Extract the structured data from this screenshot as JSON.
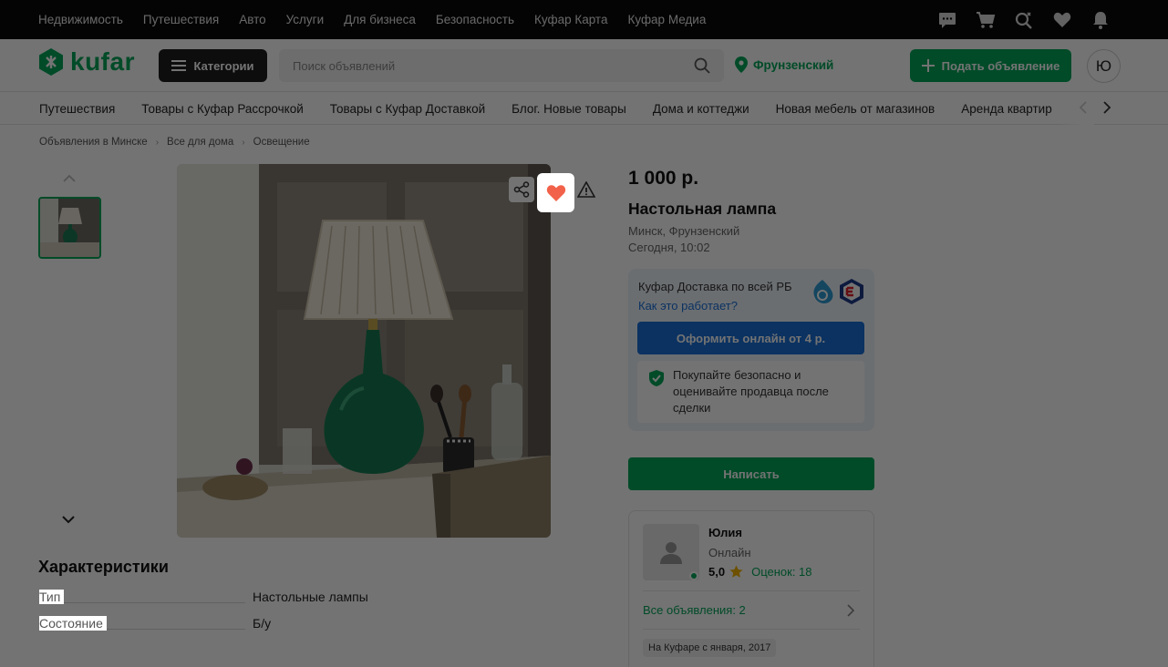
{
  "topbar": {
    "links": [
      "Недвижимость",
      "Путешествия",
      "Авто",
      "Услуги",
      "Для бизнеса",
      "Безопасность",
      "Куфар Карта",
      "Куфар Медиа"
    ],
    "icons": [
      "messages-icon",
      "cart-icon",
      "saved-search-icon",
      "favorites-icon",
      "notifications-icon"
    ]
  },
  "header": {
    "logo_text": "kufar",
    "categories_label": "Категории",
    "search_placeholder": "Поиск объявлений",
    "location_label": "Фрунзенский",
    "post_ad_label": "Подать объявление",
    "avatar_letter": "Ю"
  },
  "quick_nav": {
    "items": [
      "Путешествия",
      "Товары с Куфар Рассрочкой",
      "Товары с Куфар Доставкой",
      "Блог. Новые товары",
      "Дома и коттеджи",
      "Новая мебель от магазинов",
      "Аренда квартир"
    ]
  },
  "breadcrumbs": [
    "Объявления в Минске",
    "Все для дома",
    "Освещение"
  ],
  "listing": {
    "price": "1 000 р.",
    "title": "Настольная лампа",
    "location": "Минск, Фрунзенский",
    "posted": "Сегодня, 10:02"
  },
  "delivery": {
    "title": "Куфар Доставка по всей РБ",
    "link": "Как это работает?",
    "button": "Оформить онлайн от 4 р.",
    "safe_text": "Покупайте безопасно и оценивайте продавца после сделки"
  },
  "write_button": "Написать",
  "seller": {
    "name": "Юлия",
    "status": "Онлайн",
    "rating": "5,0",
    "reviews": "Оценок: 18",
    "all_ads": "Все объявления: 2",
    "since": "На Куфаре с января, 2017"
  },
  "characteristics": {
    "title": "Характеристики",
    "rows": [
      {
        "key": "Тип",
        "value": "Настольные лампы"
      },
      {
        "key": "Состояние",
        "value": "Б/у"
      }
    ]
  },
  "colors": {
    "brand_green": "#03a659",
    "delivery_blue": "#1a6fd8",
    "fav_heart": "#f2624a",
    "overlay": "rgba(0,0,0,0.55)"
  }
}
